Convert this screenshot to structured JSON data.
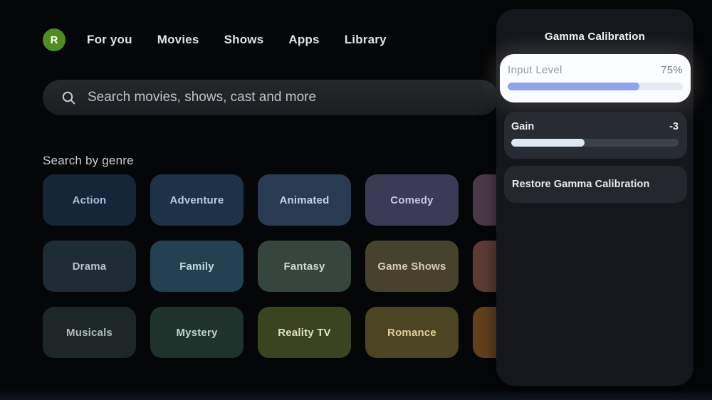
{
  "nav": {
    "avatar_initial": "R",
    "avatar_color": "#4f8d21",
    "items": [
      "For you",
      "Movies",
      "Shows",
      "Apps",
      "Library"
    ]
  },
  "search": {
    "placeholder": "Search movies, shows, cast and more"
  },
  "genre_section": {
    "heading": "Search by genre",
    "tiles": [
      {
        "label": "Action",
        "bg": "#152638",
        "fg": "#aabfdc"
      },
      {
        "label": "Adventure",
        "bg": "#1d3147",
        "fg": "#bac9e0"
      },
      {
        "label": "Animated",
        "bg": "#293b51",
        "fg": "#c2d1e6"
      },
      {
        "label": "Comedy",
        "bg": "#3c3b55",
        "fg": "#c9c4e8"
      },
      {
        "label": "",
        "bg": "#4d3a49",
        "fg": "#d5c2ce"
      },
      {
        "label": "Drama",
        "bg": "#1e2c36",
        "fg": "#b5c4d2"
      },
      {
        "label": "Family",
        "bg": "#234150",
        "fg": "#c3d9e4"
      },
      {
        "label": "Fantasy",
        "bg": "#35463f",
        "fg": "#cdd9cc"
      },
      {
        "label": "Game Shows",
        "bg": "#46422c",
        "fg": "#ddcab8"
      },
      {
        "label": "",
        "bg": "#5e3c35",
        "fg": "#e0c0b5"
      },
      {
        "label": "Musicals",
        "bg": "#1d2826",
        "fg": "#aebabd"
      },
      {
        "label": "Mystery",
        "bg": "#1f332c",
        "fg": "#c1d3c8"
      },
      {
        "label": "Reality TV",
        "bg": "#3c431f",
        "fg": "#dce3bd"
      },
      {
        "label": "Romance",
        "bg": "#4c4524",
        "fg": "#e1d29a"
      },
      {
        "label": "",
        "bg": "#63401e",
        "fg": "#e4c49e"
      }
    ]
  },
  "panel": {
    "title": "Gamma Calibration",
    "items": [
      {
        "type": "slider",
        "label": "Input Level",
        "value": "75%",
        "percent": 75,
        "focused": true,
        "fill_color": "#8aa5ee",
        "track_color": "#e6eaf2"
      },
      {
        "type": "slider",
        "label": "Gain",
        "value": "-3",
        "percent": 44,
        "focused": false,
        "fill_color": "#dde8f2",
        "track_color": "#3d424a"
      },
      {
        "type": "button",
        "label": "Restore Gamma Calibration"
      }
    ]
  }
}
